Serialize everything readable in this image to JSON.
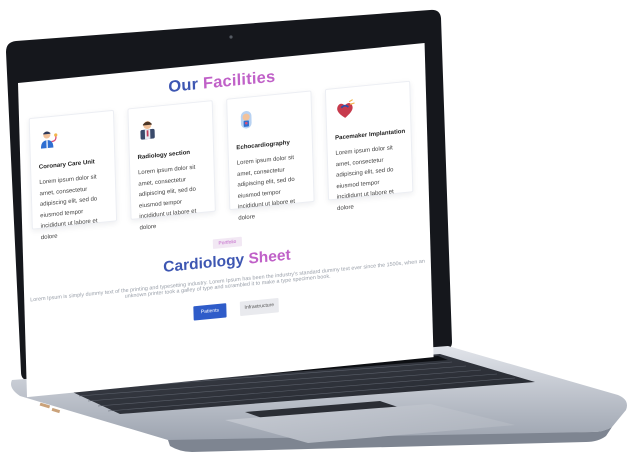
{
  "page": {
    "title_part1": "Our",
    "title_part2": "Facilities"
  },
  "facilities": [
    {
      "title": "Coronary Care Unit",
      "description": "Lorem ipsum dolor sit amet, consectetur adipiscing elit, sed do eiusmod tempor incididunt ut labore et dolore",
      "icon": "doctor-stethoscope-icon"
    },
    {
      "title": "Radiology section",
      "description": "Lorem ipsum dolor sit amet, consectetur adipiscing elit, sed do eiusmod tempor incididunt ut labore et dolore",
      "icon": "doctor-avatar-icon"
    },
    {
      "title": "Echocardiography",
      "description": "Lorem ipsum dolor sit amet, consectetur adipiscing elit, sed do eiusmod tempor incididunt ut labore et dolore",
      "icon": "echo-machine-icon"
    },
    {
      "title": "Pacemaker Implantation",
      "description": "Lorem ipsum dolor sit amet, consectetur adipiscing elit, sed do eiusmod tempor incididunt ut labore et dolore",
      "icon": "heart-pacemaker-icon"
    }
  ],
  "portfolio": {
    "tag": "Portfolio",
    "title_part1": "Cardiology",
    "title_part2": "Sheet",
    "description": "Lorem Ipsum is simply dummy text of the printing and typesetting industry. Lorem Ipsum has been the industry's standard dummy text ever since the 1500s, when an unknown printer took a galley of type and scrambled it to make a type specimen book.",
    "buttons": [
      {
        "label": "Patients"
      },
      {
        "label": "Infrastructure"
      }
    ]
  },
  "colors": {
    "accent_blue": "#3d56b2",
    "accent_pink": "#c061c8",
    "button_blue": "#2f5cc9",
    "laptop_body": "#b6bcc6",
    "laptop_bezel": "#15171c"
  }
}
